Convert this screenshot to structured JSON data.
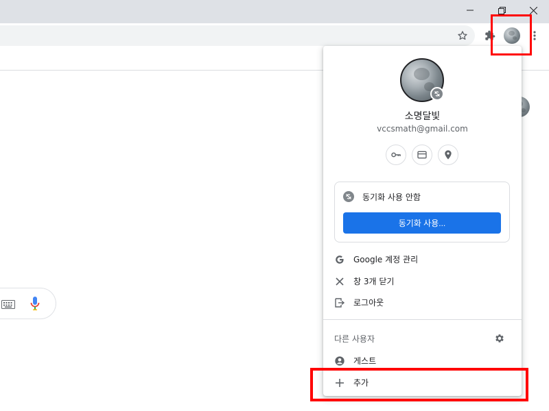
{
  "window": {
    "minimize_icon": "minimize-icon",
    "restore_icon": "restore-icon",
    "close_icon": "close-icon"
  },
  "toolbar": {
    "bookmark_icon": "star-icon",
    "extensions_icon": "puzzle-icon",
    "menu_icon": "kebab-menu-icon"
  },
  "profile_menu": {
    "name": "소명달빛",
    "email": "vccsmath@gmail.com",
    "quick_buttons": [
      "key-icon",
      "credit-card-icon",
      "location-pin-icon"
    ],
    "sync_status": "동기화 사용 안함",
    "sync_button": "동기화 사용...",
    "items": [
      {
        "icon": "google-g-icon",
        "label": "Google 계정 관리"
      },
      {
        "icon": "close-icon",
        "label": "창 3개 닫기"
      },
      {
        "icon": "logout-icon",
        "label": "로그아웃"
      }
    ],
    "other_users_label": "다른 사용자",
    "guest_label": "게스트",
    "add_label": "추가"
  },
  "colors": {
    "accent": "#1a73e8",
    "highlight": "#ff0000"
  }
}
